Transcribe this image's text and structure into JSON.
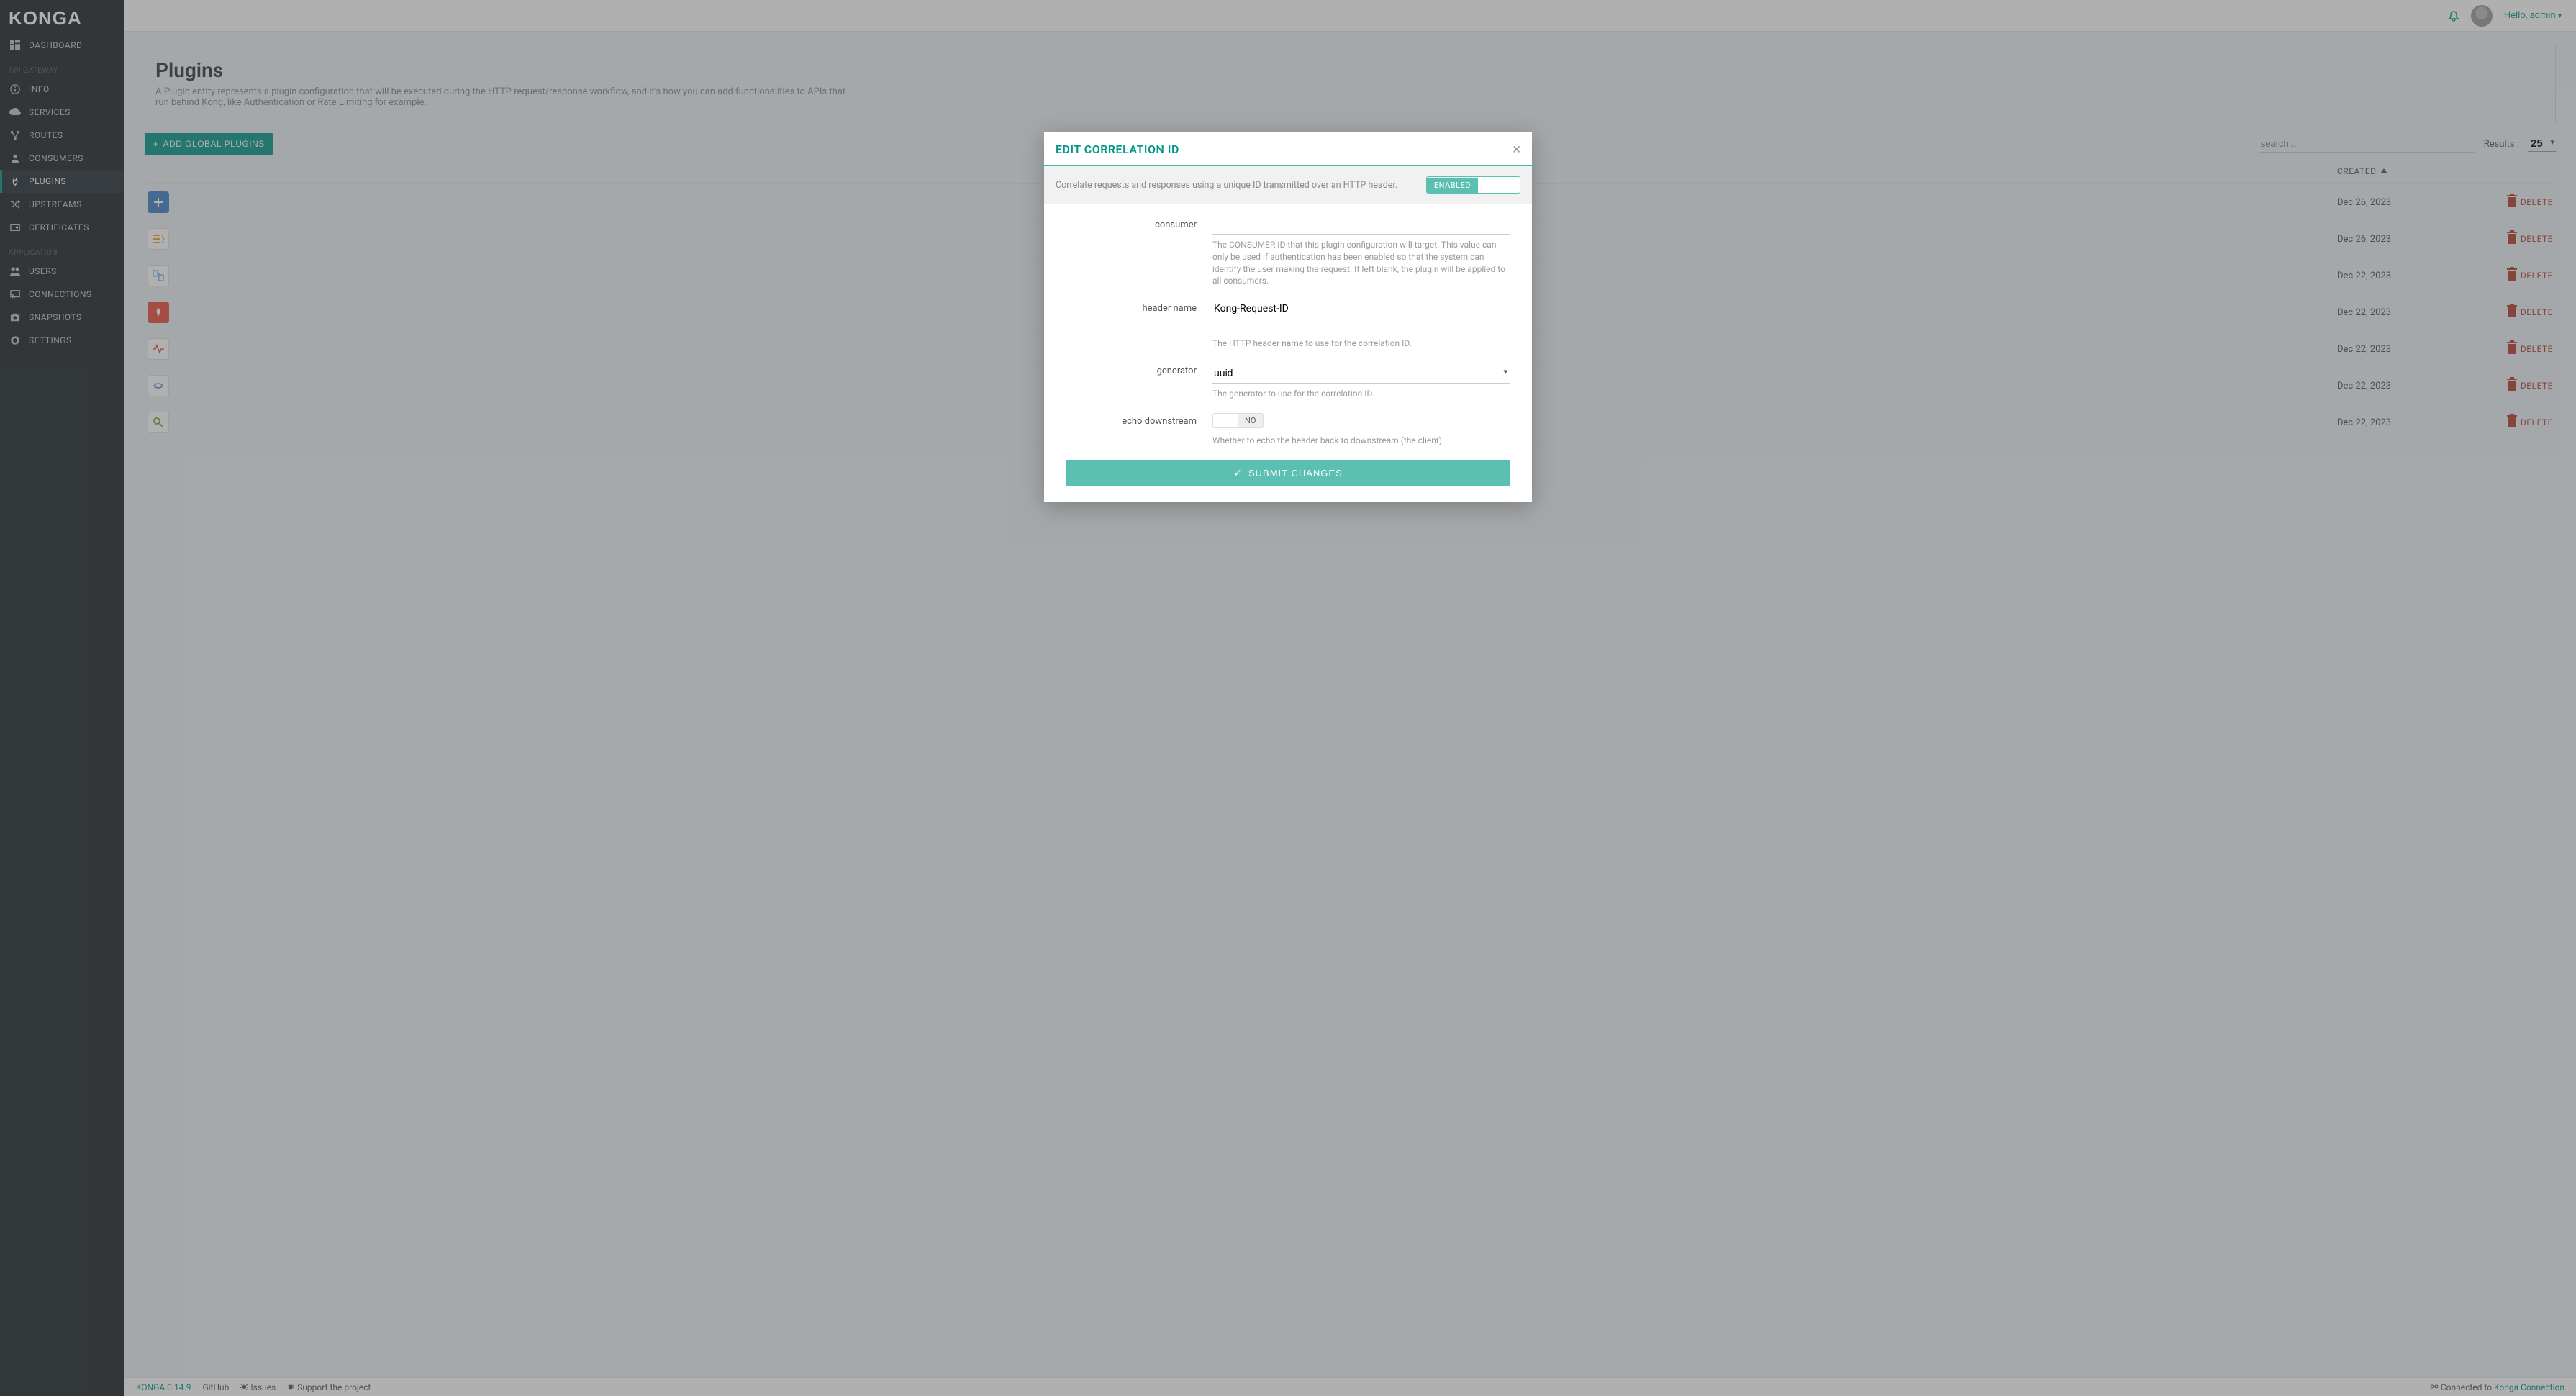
{
  "brand": "KONGA",
  "topbar": {
    "greeting": "Hello, admin"
  },
  "sidebar": {
    "sections": [
      {
        "label": "",
        "items": [
          {
            "key": "dashboard",
            "label": "DASHBOARD"
          }
        ]
      },
      {
        "label": "API GATEWAY",
        "items": [
          {
            "key": "info",
            "label": "INFO"
          },
          {
            "key": "services",
            "label": "SERVICES"
          },
          {
            "key": "routes",
            "label": "ROUTES"
          },
          {
            "key": "consumers",
            "label": "CONSUMERS"
          },
          {
            "key": "plugins",
            "label": "PLUGINS",
            "active": true
          },
          {
            "key": "upstreams",
            "label": "UPSTREAMS"
          },
          {
            "key": "certificates",
            "label": "CERTIFICATES"
          }
        ]
      },
      {
        "label": "APPLICATION",
        "items": [
          {
            "key": "users",
            "label": "USERS"
          },
          {
            "key": "connections",
            "label": "CONNECTIONS"
          },
          {
            "key": "snapshots",
            "label": "SNAPSHOTS"
          },
          {
            "key": "settings",
            "label": "SETTINGS"
          }
        ]
      }
    ]
  },
  "page": {
    "title": "Plugins",
    "description": "A Plugin entity represents a plugin configuration that will be executed during the HTTP request/response workflow, and it's how you can add functionalities to APIs that run behind Kong, like Authentication or Rate Limiting for example.",
    "add_button": "ADD GLOBAL PLUGINS",
    "search_placeholder": "search...",
    "results_label": "Results :",
    "results_value": "25",
    "columns": {
      "created": "CREATED"
    },
    "rows": [
      {
        "icon": "cors",
        "color": "#3b82c4",
        "created": "Dec 26, 2023"
      },
      {
        "icon": "acl",
        "color": "#ecf0f5",
        "created": "Dec 26, 2023"
      },
      {
        "icon": "request-transformer",
        "color": "#ecf0f5",
        "created": "Dec 22, 2023"
      },
      {
        "icon": "prometheus",
        "color": "#e74c3c",
        "created": "Dec 22, 2023"
      },
      {
        "icon": "rate-limiting",
        "color": "#ecf0f5",
        "created": "Dec 22, 2023"
      },
      {
        "icon": "correlation-id",
        "color": "#ecf0f5",
        "created": "Dec 22, 2023"
      },
      {
        "icon": "key-auth",
        "color": "#ecf0f5",
        "created": "Dec 22, 2023"
      }
    ],
    "delete_label": "DELETE"
  },
  "modal": {
    "title": "EDIT CORRELATION ID",
    "subtitle": "Correlate requests and responses using a unique ID transmitted over an HTTP header.",
    "enabled_label": "ENABLED",
    "fields": {
      "consumer": {
        "label": "consumer",
        "value": "",
        "help": "The CONSUMER ID that this plugin configuration will target. This value can only be used if authentication has been enabled so that the system can identify the user making the request. If left blank, the plugin will be applied to all consumers."
      },
      "header_name": {
        "label": "header name",
        "value": "Kong-Request-ID",
        "help": "The HTTP header name to use for the correlation ID."
      },
      "generator": {
        "label": "generator",
        "value": "uuid",
        "help": "The generator to use for the correlation ID."
      },
      "echo_downstream": {
        "label": "echo downstream",
        "value": "NO",
        "help": "Whether to echo the header back to downstream (the client)."
      }
    },
    "submit": "SUBMIT CHANGES"
  },
  "footer": {
    "version": "KONGA 0.14.9",
    "github": "GitHub",
    "issues": "Issues",
    "support": "Support the project",
    "connected_prefix": "Connected to ",
    "connection": "Konga Connection"
  }
}
